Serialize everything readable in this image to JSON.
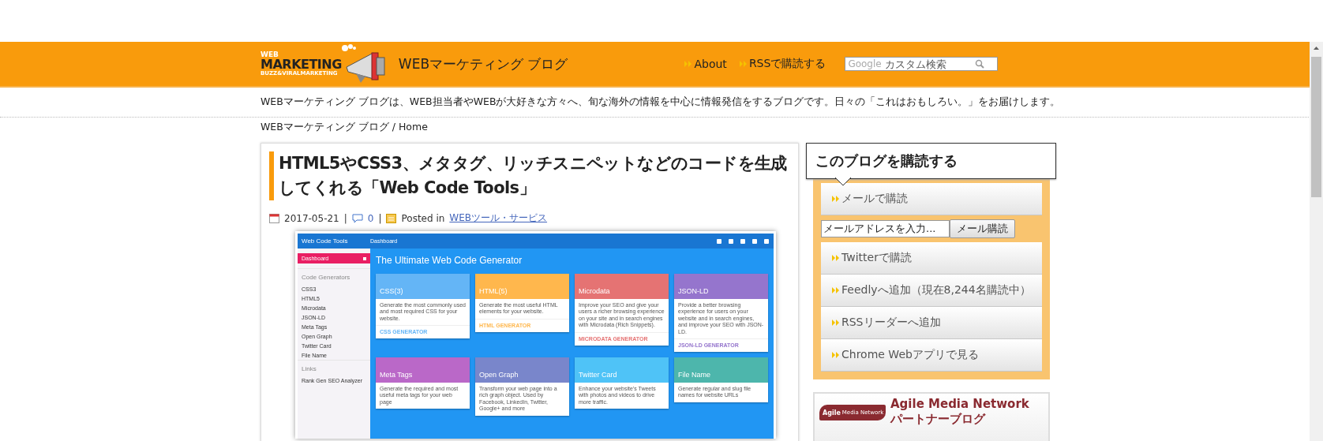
{
  "header": {
    "logo": {
      "small": "WEB",
      "main": "MARKETING",
      "tagline": "BUZZ&VIRALMARKETING"
    },
    "site_title": "WEBマーケティング ブログ",
    "nav": [
      "About",
      "RSSで購読する"
    ],
    "search": {
      "brand": "Google",
      "placeholder": "カスタム検索"
    }
  },
  "tagline": "WEBマーケティング ブログは、WEB担当者やWEBが大好きな方々へ、旬な海外の情報を中心に情報発信をするブログです。日々の「これはおもしろい。」をお届けします。",
  "breadcrumb": "WEBマーケティング ブログ / Home",
  "article": {
    "title": "HTML5やCSS3、メタタグ、リッチスニペットなどのコードを生成してくれる「Web Code Tools」",
    "meta": [
      {
        "kind": "date",
        "text": "2017-05-21"
      },
      {
        "kind": "separator",
        "text": "|"
      },
      {
        "kind": "comments",
        "text": "0"
      },
      {
        "kind": "separator",
        "text": "|"
      },
      {
        "kind": "category",
        "label": "Posted in",
        "text": "WEBツール・サービス"
      }
    ],
    "screenshot": {
      "app_title": "Web Code Tools",
      "breadcrumb": "Dashboard",
      "heading": "The Ultimate Web Code Generator",
      "sidebar": [
        {
          "kind": "item",
          "label": "Dashboard",
          "selected": true
        },
        {
          "kind": "heading",
          "label": "Code Generators"
        },
        {
          "kind": "item",
          "label": "CSS3",
          "selected": false
        },
        {
          "kind": "item",
          "label": "HTML5",
          "selected": false
        },
        {
          "kind": "item",
          "label": "Microdata",
          "selected": false
        },
        {
          "kind": "item",
          "label": "JSON-LD",
          "selected": false
        },
        {
          "kind": "item",
          "label": "Meta Tags",
          "selected": false
        },
        {
          "kind": "item",
          "label": "Open Graph",
          "selected": false
        },
        {
          "kind": "item",
          "label": "Twitter Card",
          "selected": false
        },
        {
          "kind": "item",
          "label": "File Name",
          "selected": false
        },
        {
          "kind": "heading",
          "label": "Links"
        },
        {
          "kind": "item",
          "label": "Rank Gen SEO Analyzer",
          "selected": false
        }
      ],
      "cards": [
        {
          "title": "CSS(3)",
          "color": "#64b5f6",
          "description": "Generate the most commonly used and most required CSS for your website.",
          "link": "CSS GENERATOR"
        },
        {
          "title": "HTML(5)",
          "color": "#ffb74d",
          "description": "Generate the most useful HTML elements for your website.",
          "link": "HTML GENERATOR"
        },
        {
          "title": "Microdata",
          "color": "#e57373",
          "description": "Improve your SEO and give your users a richer browsing experience on your site and in search engines with Microdata (Rich Snippets).",
          "link": "MICRODATA GENERATOR"
        },
        {
          "title": "JSON-LD",
          "color": "#9575cd",
          "description": "Provide a better browsing experience for users on your website and in search engines, and improve your SEO with JSON-LD.",
          "link": "JSON-LD GENERATOR"
        },
        {
          "title": "Meta Tags",
          "color": "#ba68c8",
          "description": "Generate the required and most useful meta tags for your web page"
        },
        {
          "title": "Open Graph",
          "color": "#7986cb",
          "description": "Transform your web page into a rich graph object. Used by Facebook, LinkedIn, Twitter, Google+ and more"
        },
        {
          "title": "Twitter Card",
          "color": "#4fc3f7",
          "description": "Enhance your website's Tweets with photos and videos to drive more traffic."
        },
        {
          "title": "File Name",
          "color": "#4db6ac",
          "description": "Generate regular and slug file names for website URLs"
        }
      ]
    }
  },
  "subscribe": {
    "heading": "このブログを購読する",
    "items": [
      {
        "kind": "link",
        "label": "メールで購読"
      },
      {
        "kind": "form",
        "value": "メールアドレスを入力...",
        "button": "メール購読"
      },
      {
        "kind": "link",
        "label": "Twitterで購読"
      },
      {
        "kind": "link",
        "label": "Feedlyへ追加（現在8,244名購読中）"
      },
      {
        "kind": "link",
        "label": "RSSリーダーへ追加"
      },
      {
        "kind": "link",
        "label": "Chrome Webアプリで見る"
      }
    ]
  },
  "partner": {
    "logo": {
      "main": "Agile",
      "sub": "Media Network"
    },
    "title": "Agile Media Network",
    "subtitle": "パートナーブログ"
  }
}
